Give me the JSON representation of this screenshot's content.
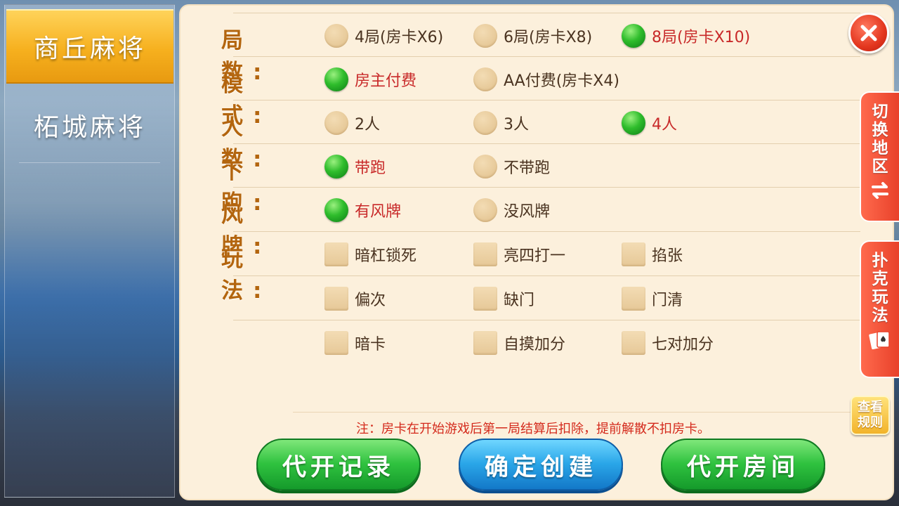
{
  "sidebar": {
    "tabs": [
      {
        "label": "商丘麻将",
        "active": true
      },
      {
        "label": "柘城麻将",
        "active": false
      }
    ]
  },
  "rows": [
    {
      "label": "局数:",
      "type": "radio",
      "options": [
        {
          "text": "4局(房卡X6)",
          "selected": false
        },
        {
          "text": "6局(房卡X8)",
          "selected": false
        },
        {
          "text": "8局(房卡X10)",
          "selected": true
        }
      ]
    },
    {
      "label": "模式:",
      "type": "radio",
      "options": [
        {
          "text": "房主付费",
          "selected": true
        },
        {
          "text": "AA付费(房卡X4)",
          "selected": false
        }
      ]
    },
    {
      "label": "人数:",
      "type": "radio",
      "options": [
        {
          "text": "2人",
          "selected": false
        },
        {
          "text": "3人",
          "selected": false
        },
        {
          "text": "4人",
          "selected": true
        }
      ]
    },
    {
      "label": "下跑:",
      "type": "radio",
      "options": [
        {
          "text": "带跑",
          "selected": true
        },
        {
          "text": "不带跑",
          "selected": false
        }
      ]
    },
    {
      "label": "风牌:",
      "type": "radio",
      "options": [
        {
          "text": "有风牌",
          "selected": true
        },
        {
          "text": "没风牌",
          "selected": false
        }
      ]
    },
    {
      "label": "玩法:",
      "type": "check",
      "options": [
        {
          "text": "暗杠锁死",
          "selected": false
        },
        {
          "text": "亮四打一",
          "selected": false
        },
        {
          "text": "掐张",
          "selected": false
        }
      ]
    },
    {
      "label": "",
      "type": "check",
      "options": [
        {
          "text": "偏次",
          "selected": false
        },
        {
          "text": "缺门",
          "selected": false
        },
        {
          "text": "门清",
          "selected": false
        }
      ]
    },
    {
      "label": "",
      "type": "check",
      "options": [
        {
          "text": "暗卡",
          "selected": false
        },
        {
          "text": "自摸加分",
          "selected": false
        },
        {
          "text": "七对加分",
          "selected": false
        }
      ]
    }
  ],
  "note": "注：房卡在开始游戏后第一局结算后扣除，提前解散不扣房卡。",
  "buttons": {
    "record": "代开记录",
    "create": "确定创建",
    "room": "代开房间"
  },
  "side_tabs": {
    "switch_region": [
      "切",
      "换",
      "地",
      "区"
    ],
    "switch_region_icon": "swap-arrows-icon",
    "poker": [
      "扑",
      "克",
      "玩",
      "法"
    ],
    "poker_icon": "playing-cards-icon"
  },
  "rules_button": [
    "查看",
    "规则"
  ],
  "colors": {
    "label": "#b3650e",
    "selected_text": "#c82929",
    "normal_text": "#4a3320",
    "note": "#d42a1c"
  }
}
